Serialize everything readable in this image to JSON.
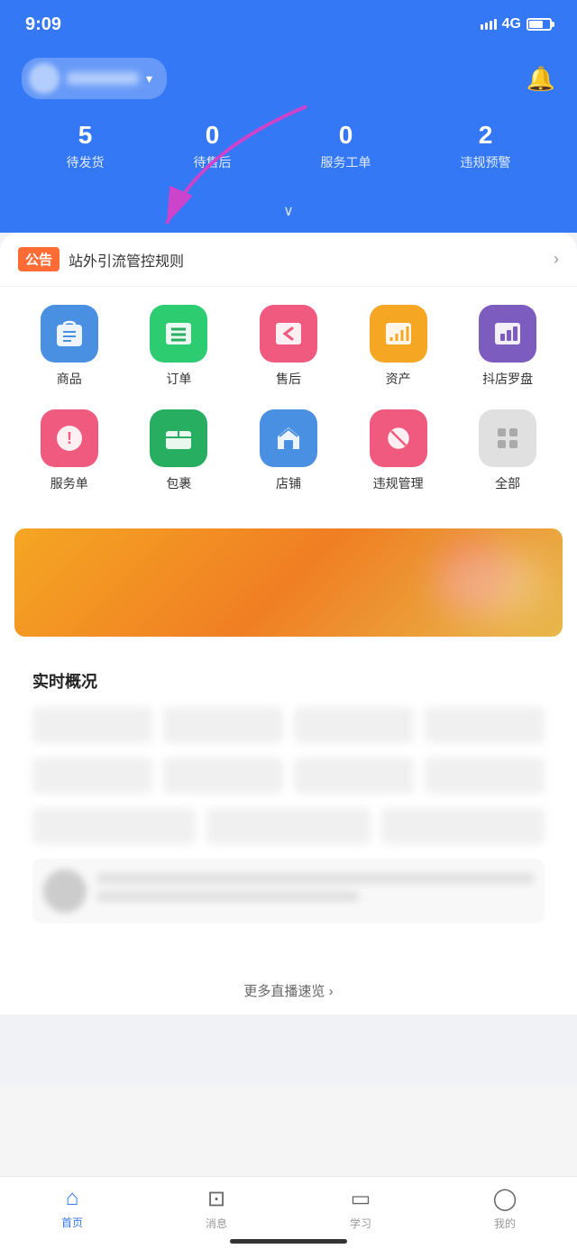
{
  "statusBar": {
    "time": "9:09",
    "signal": "4G"
  },
  "header": {
    "storeName": "店铺名称",
    "bellLabel": "通知"
  },
  "stats": [
    {
      "number": "5",
      "label": "待发货"
    },
    {
      "number": "0",
      "label": "待售后"
    },
    {
      "number": "0",
      "label": "服务工单"
    },
    {
      "number": "2",
      "label": "违规预警"
    }
  ],
  "announcement": {
    "tag": "公告",
    "text": "站外引流管控规则",
    "arrow": "›"
  },
  "menuRow1": [
    {
      "id": "product",
      "label": "商品",
      "icon": "🛍",
      "colorClass": "icon-blue"
    },
    {
      "id": "order",
      "label": "订单",
      "icon": "☰",
      "colorClass": "icon-green"
    },
    {
      "id": "aftersale",
      "label": "售后",
      "icon": "↩",
      "colorClass": "icon-pink"
    },
    {
      "id": "asset",
      "label": "资产",
      "icon": "📋",
      "colorClass": "icon-orange"
    },
    {
      "id": "douyin",
      "label": "抖店罗盘",
      "icon": "📊",
      "colorClass": "icon-purple"
    }
  ],
  "menuRow2": [
    {
      "id": "service",
      "label": "服务单",
      "icon": "!",
      "colorClass": "icon-red"
    },
    {
      "id": "package",
      "label": "包裹",
      "icon": "📦",
      "colorClass": "icon-darkgreen"
    },
    {
      "id": "store",
      "label": "店铺",
      "icon": "🏠",
      "colorClass": "icon-bluelight"
    },
    {
      "id": "violation",
      "label": "违规管理",
      "icon": "⊘",
      "colorClass": "icon-redcircle"
    },
    {
      "id": "all",
      "label": "全部",
      "icon": "⠿",
      "colorClass": "icon-gray"
    }
  ],
  "realtime": {
    "title": "实时概况"
  },
  "moreLive": {
    "text": "更多直播速览 ›"
  },
  "bottomNav": [
    {
      "id": "home",
      "label": "首页",
      "icon": "⌂",
      "active": true
    },
    {
      "id": "message",
      "label": "消息",
      "icon": "💬",
      "active": false
    },
    {
      "id": "learn",
      "label": "学习",
      "icon": "📱",
      "active": false
    },
    {
      "id": "mine",
      "label": "我的",
      "icon": "👤",
      "active": false
    }
  ]
}
